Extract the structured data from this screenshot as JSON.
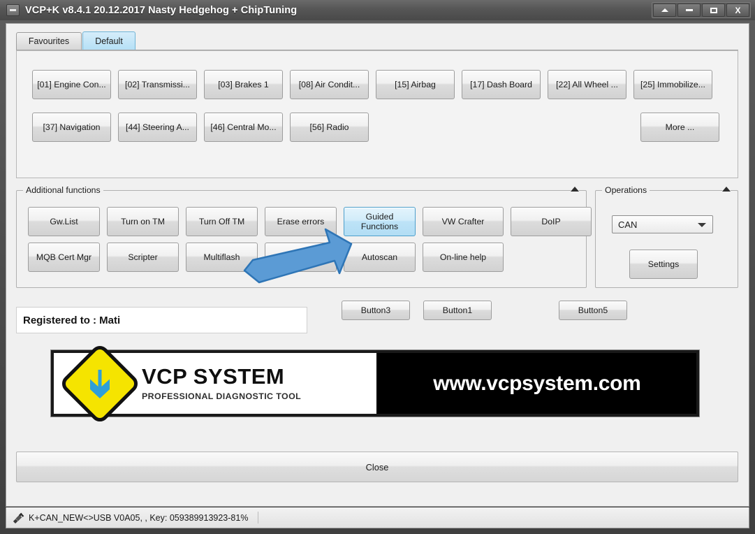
{
  "window": {
    "title": "VCP+K v8.4.1 20.12.2017 Nasty Hedgehog + ChipTuning",
    "sysmenu_icon": "window-menu-icon",
    "controls": [
      {
        "name": "rollup-button",
        "icon": "chevron-up-icon"
      },
      {
        "name": "minimize-button",
        "icon": "minimize-icon"
      },
      {
        "name": "maximize-button",
        "icon": "maximize-icon"
      },
      {
        "name": "close-button",
        "icon": "close-icon",
        "label": "X"
      }
    ]
  },
  "tabs": [
    {
      "label": "Favourites",
      "active": false
    },
    {
      "label": "Default",
      "active": true
    }
  ],
  "modules": {
    "row1": [
      {
        "label": "[01] Engine Con..."
      },
      {
        "label": "[02] Transmissi..."
      },
      {
        "label": "[03] Brakes 1"
      },
      {
        "label": "[08] Air Condit..."
      },
      {
        "label": "[15] Airbag"
      },
      {
        "label": "[17] Dash Board"
      },
      {
        "label": "[22] All Wheel ..."
      },
      {
        "label": "[25] Immobilize..."
      }
    ],
    "row2": [
      {
        "label": "[37] Navigation"
      },
      {
        "label": "[44] Steering A..."
      },
      {
        "label": "[46] Central Mo..."
      },
      {
        "label": "[56] Radio"
      }
    ],
    "more_label": "More ..."
  },
  "additional_functions": {
    "title": "Additional functions",
    "collapse_icon": "triangle-up-icon",
    "row1": [
      {
        "label": "Gw.List",
        "highlighted": false
      },
      {
        "label": "Turn on TM",
        "highlighted": false
      },
      {
        "label": "Turn Off TM",
        "highlighted": false
      },
      {
        "label": "Erase errors",
        "highlighted": false
      },
      {
        "label": "Guided Functions",
        "highlighted": true
      },
      {
        "label": "VW Crafter",
        "highlighted": false
      },
      {
        "label": "DoIP",
        "highlighted": false
      }
    ],
    "row2": [
      {
        "label": "MQB Cert Mgr",
        "highlighted": false
      },
      {
        "label": "Scripter",
        "highlighted": false
      },
      {
        "label": "Multiflash",
        "highlighted": false
      },
      {
        "label": "",
        "highlighted": false
      },
      {
        "label": "Autoscan",
        "highlighted": false
      },
      {
        "label": "On-line help",
        "highlighted": false
      }
    ]
  },
  "operations": {
    "title": "Operations",
    "collapse_icon": "triangle-up-icon",
    "interface_value": "CAN",
    "settings_label": "Settings"
  },
  "registration": {
    "text": "Registered to : Mati"
  },
  "extra_buttons": [
    {
      "label": "Button3"
    },
    {
      "label": "Button1"
    },
    {
      "label": "Button5"
    }
  ],
  "banner": {
    "logo_icon": "vcp-diamond-arrow-logo",
    "brand": "VCP SYSTEM",
    "tagline": "PROFESSIONAL DIAGNOSTIC TOOL",
    "url": "www.vcpsystem.com",
    "colors": {
      "diamond": "#f5e400",
      "arrow": "#2f9fd8",
      "background": "#000000"
    }
  },
  "footer": {
    "close_label": "Close"
  },
  "statusbar": {
    "icon": "plug-connector-icon",
    "text": "K+CAN_NEW<>USB V0A05, , Key: 059389913923-81%"
  },
  "annotation": {
    "arrow_icon": "pointer-arrow-icon",
    "color": "#5b9bd5",
    "outline": "#2e75b6",
    "points_to": "Guided Functions"
  }
}
